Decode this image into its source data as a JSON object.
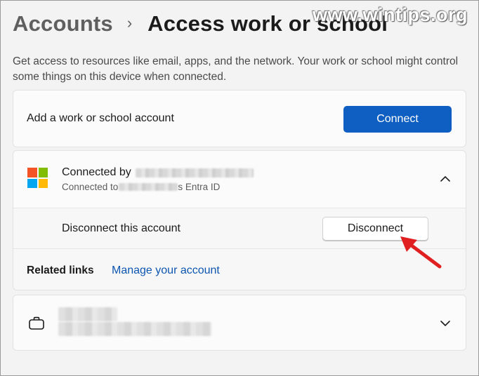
{
  "breadcrumb": {
    "parent": "Accounts",
    "separator": "›",
    "title": "Access work or school"
  },
  "watermark": "www.wintips.org",
  "description": "Get access to resources like email, apps, and the network. Your work or school might control some things on this device when connected.",
  "add_account": {
    "label": "Add a work or school account",
    "button": "Connect"
  },
  "account": {
    "title_prefix": "Connected by",
    "subtitle_prefix": "Connected to",
    "subtitle_suffix": "s Entra ID",
    "logo_colors": [
      "#f35325",
      "#81bc06",
      "#05a6f0",
      "#ffba08"
    ],
    "disconnect_label": "Disconnect this account",
    "disconnect_button": "Disconnect",
    "related_label": "Related links",
    "manage_link": "Manage your account"
  },
  "icons": {
    "expand_up": "chevron-up-icon",
    "expand_down": "chevron-down-icon",
    "other_account": "briefcase-icon",
    "annotation": "red-arrow-icon"
  },
  "colors": {
    "accent": "#0e5fc1",
    "link": "#0d55b0",
    "annotation_arrow": "#e02020"
  }
}
